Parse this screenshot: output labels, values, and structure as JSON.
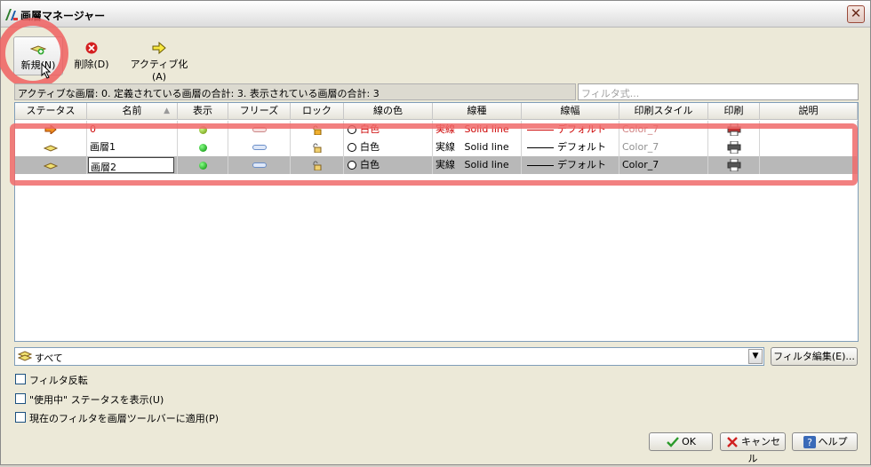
{
  "window": {
    "title": "画層マネージャー",
    "close_glyph": "✕"
  },
  "toolbar": {
    "new_label": "新規(N)",
    "delete_label": "削除(D)",
    "activate_label": "アクティブ化(A)"
  },
  "status_text": "アクティブな画層: 0. 定義されている画層の合計: 3. 表示されている画層の合計: 3",
  "filter_placeholder": "フィルタ式...",
  "columns": [
    "ステータス",
    "名前",
    "表示",
    "フリーズ",
    "ロック",
    "線の色",
    "線種",
    "線幅",
    "印刷スタイル",
    "印刷",
    "説明"
  ],
  "sort_glyph": "▲",
  "layers": [
    {
      "name": "0",
      "color": "白色",
      "linetype_jp": "実線",
      "linetype": "Solid line",
      "lineweight": "デフォルト",
      "plotstyle": "Color_7"
    },
    {
      "name": "画層1",
      "color": "白色",
      "linetype_jp": "実線",
      "linetype": "Solid line",
      "lineweight": "デフォルト",
      "plotstyle": "Color_7"
    },
    {
      "name": "画層2",
      "color": "白色",
      "linetype_jp": "実線",
      "linetype": "Solid line",
      "lineweight": "デフォルト",
      "plotstyle": "Color_7"
    }
  ],
  "filter_bar": {
    "value": "すべて",
    "edit_label": "フィルタ編集(E)..."
  },
  "checkboxes": {
    "invert": "フィルタ反転",
    "show_in_use": "\"使用中\" ステータスを表示(U)",
    "apply_toolbar": "現在のフィルタを画層ツールバーに適用(P)"
  },
  "buttons": {
    "ok": "OK",
    "cancel": "キャンセル",
    "help": "ヘルプ"
  },
  "colors": {
    "accent_red": "#f06060",
    "current_row_text": "#cc0000",
    "selected_row": "#b8b8b8"
  }
}
